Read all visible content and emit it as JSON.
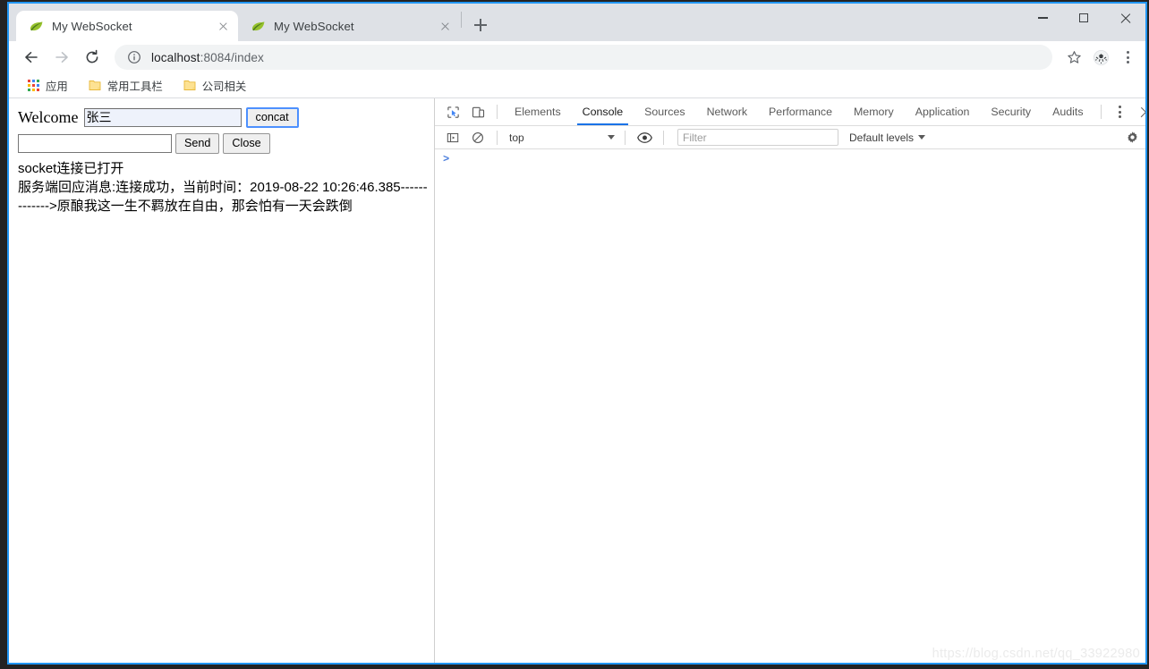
{
  "window": {
    "controls": {
      "minimize": "minimize",
      "maximize": "maximize",
      "close": "close"
    }
  },
  "tabs": [
    {
      "title": "My WebSocket",
      "favicon": "leaf-icon",
      "active": true
    },
    {
      "title": "My WebSocket",
      "favicon": "leaf-icon",
      "active": false
    }
  ],
  "new_tab_label": "+",
  "toolbar": {
    "back": "back-arrow-icon",
    "forward": "forward-arrow-icon",
    "reload": "reload-icon",
    "info_icon": "info-circle-icon",
    "url_host": "localhost",
    "url_path": ":8084/index",
    "bookmark_star": "star-icon",
    "profile": "profile-avatar-icon",
    "menu": "three-dot-menu-icon"
  },
  "bookmarks": [
    {
      "label": "应用",
      "icon": "apps-grid-icon"
    },
    {
      "label": "常用工具栏",
      "icon": "folder-icon"
    },
    {
      "label": "公司相关",
      "icon": "folder-icon"
    }
  ],
  "page": {
    "welcome_label": "Welcome",
    "user_input_value": "张三",
    "concat_button": "concat",
    "message_input_value": "",
    "send_button": "Send",
    "close_button": "Close",
    "log_lines": [
      "socket连接已打开",
      "服务端回应消息:连接成功，当前时间：2019-08-22 10:26:46.385------------->原酿我这一生不羁放在自由，那会怕有一天会跌倒"
    ]
  },
  "devtools": {
    "inspect_icon": "inspect-element-icon",
    "device_toolbar_icon": "device-toggle-icon",
    "tabs": [
      {
        "label": "Elements",
        "active": false
      },
      {
        "label": "Console",
        "active": true
      },
      {
        "label": "Sources",
        "active": false
      },
      {
        "label": "Network",
        "active": false
      },
      {
        "label": "Performance",
        "active": false
      },
      {
        "label": "Memory",
        "active": false
      },
      {
        "label": "Application",
        "active": false
      },
      {
        "label": "Security",
        "active": false
      },
      {
        "label": "Audits",
        "active": false
      }
    ],
    "more_tools_icon": "kebab-menu-icon",
    "close_icon": "close-devtools-icon",
    "console_toolbar": {
      "sidebar_toggle_icon": "console-sidebar-icon",
      "clear_icon": "clear-console-icon",
      "context": "top",
      "eye_icon": "live-expression-eye-icon",
      "filter_placeholder": "Filter",
      "filter_value": "",
      "levels": "Default levels",
      "settings_icon": "settings-gear-icon"
    },
    "prompt_caret": ">"
  },
  "watermark": "https://blog.csdn.net/qq_33922980",
  "colors": {
    "accent_blue": "#1a73e8",
    "window_border": "#2196f3",
    "tab_strip_bg": "#dee1e6",
    "desktop_bg": "#232323",
    "focus_ring": "#4d90fe"
  }
}
